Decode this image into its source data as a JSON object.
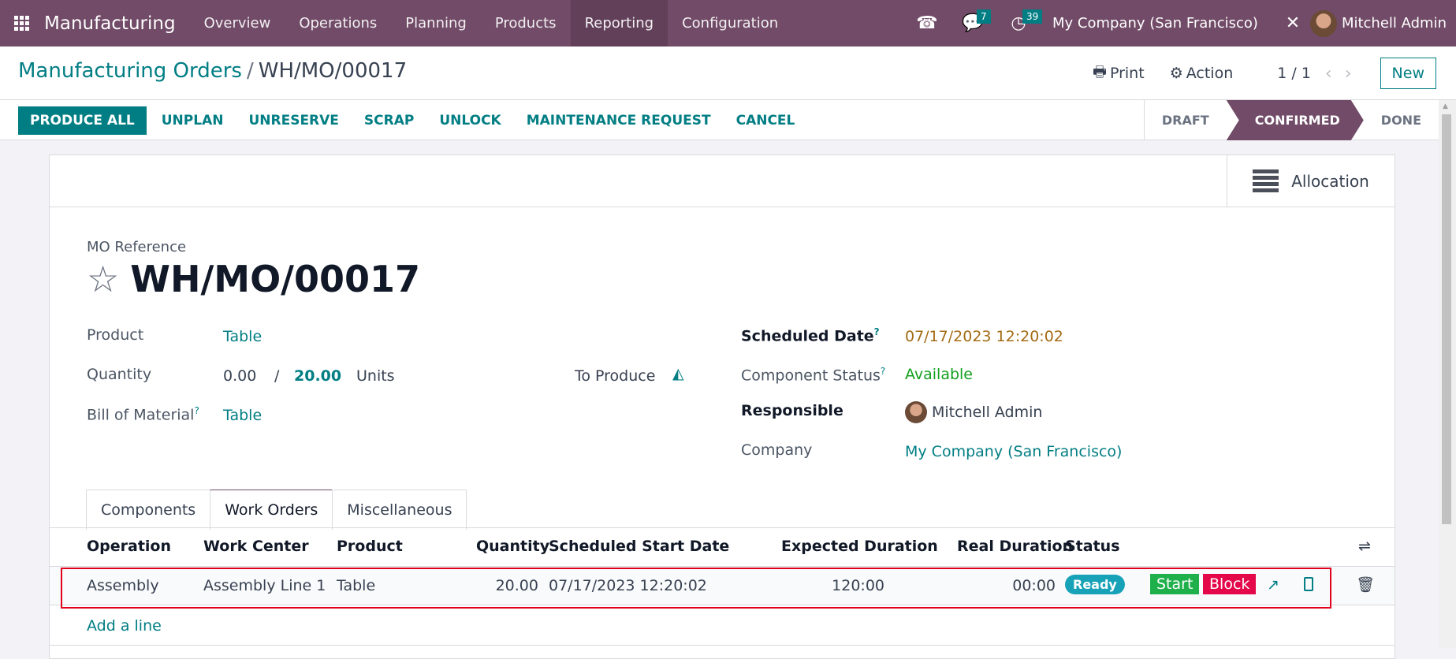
{
  "navbar": {
    "app_name": "Manufacturing",
    "menu": [
      "Overview",
      "Operations",
      "Planning",
      "Products",
      "Reporting",
      "Configuration"
    ],
    "active_menu": "Reporting",
    "messages_count": "7",
    "activities_count": "39",
    "company": "My Company (San Francisco)",
    "user": "Mitchell Admin"
  },
  "control_panel": {
    "breadcrumb_parent": "Manufacturing Orders",
    "breadcrumb_separator": "/",
    "breadcrumb_current": "WH/MO/00017",
    "print_label": "Print",
    "action_label": "Action",
    "pager": "1 / 1",
    "new_label": "New"
  },
  "actions": [
    "PRODUCE ALL",
    "UNPLAN",
    "UNRESERVE",
    "SCRAP",
    "UNLOCK",
    "MAINTENANCE REQUEST",
    "CANCEL"
  ],
  "statusbar": {
    "stages": [
      "DRAFT",
      "CONFIRMED",
      "DONE"
    ],
    "current": "CONFIRMED"
  },
  "form": {
    "allocation_label": "Allocation",
    "mo_reference_label": "MO Reference",
    "mo_reference": "WH/MO/00017",
    "product_label": "Product",
    "product": "Table",
    "quantity_label": "Quantity",
    "quantity_produced": "0.00",
    "quantity_separator": "/",
    "quantity_total": "20.00",
    "quantity_uom": "Units",
    "to_produce_label": "To Produce",
    "bom_label": "Bill of Material",
    "bom": "Table",
    "scheduled_date_label": "Scheduled Date",
    "scheduled_date": "07/17/2023 12:20:02",
    "component_status_label": "Component Status",
    "component_status": "Available",
    "responsible_label": "Responsible",
    "responsible": "Mitchell Admin",
    "company_label": "Company",
    "company": "My Company (San Francisco)",
    "help_mark": "?"
  },
  "tabs": [
    "Components",
    "Work Orders",
    "Miscellaneous"
  ],
  "active_tab": "Work Orders",
  "work_orders": {
    "columns": [
      "Operation",
      "Work Center",
      "Product",
      "Quantity",
      "Scheduled Start Date",
      "Expected Duration",
      "Real Duration",
      "Status"
    ],
    "rows": [
      {
        "operation": "Assembly",
        "work_center": "Assembly Line 1",
        "product": "Table",
        "quantity": "20.00",
        "scheduled_start": "07/17/2023 12:20:02",
        "expected_duration": "120:00",
        "real_duration": "00:00",
        "status": "Ready",
        "start_label": "Start",
        "block_label": "Block"
      }
    ],
    "add_line_label": "Add a line"
  }
}
